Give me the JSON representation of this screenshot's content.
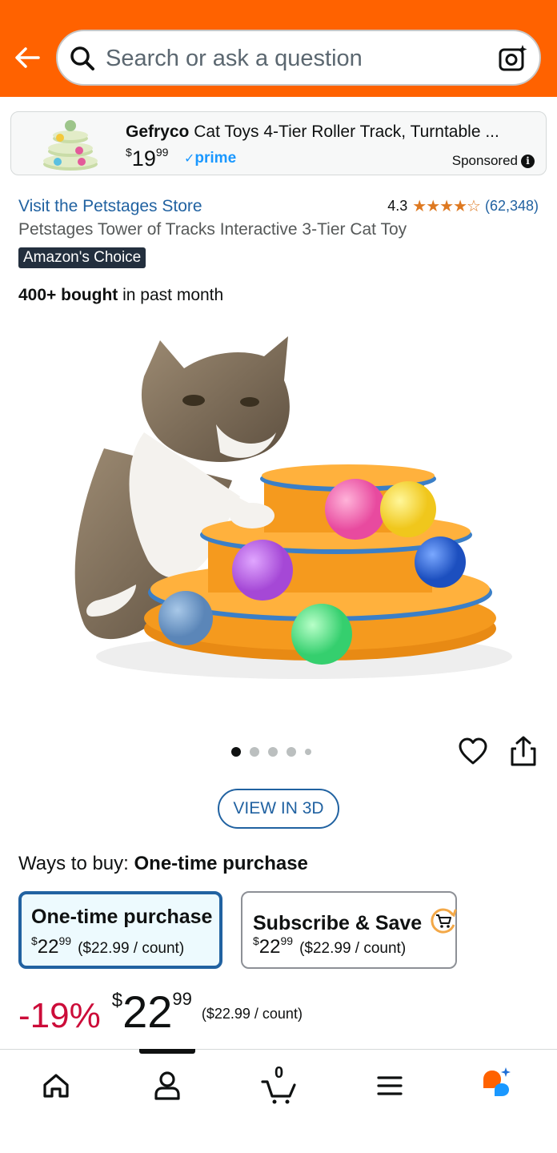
{
  "header": {
    "back_icon": "back-arrow-icon",
    "search_placeholder": "Search or ask a question",
    "camera_icon": "camera-search-icon"
  },
  "sponsored_ad": {
    "brand": "Gefryco",
    "title": "Cat Toys 4-Tier Roller Track, Turntable ...",
    "price_currency": "$",
    "price_whole": "19",
    "price_fraction": "99",
    "prime_label": "prime",
    "sponsored_label": "Sponsored",
    "info_glyph": "i"
  },
  "product": {
    "store_link": "Visit the Petstages Store",
    "rating_value": "4.3",
    "rating_stars": "★★★★☆",
    "rating_count": "(62,348)",
    "title": "Petstages Tower of Tracks Interactive 3-Tier Cat Toy",
    "badge": "Amazon's Choice",
    "bought_bold": "400+ bought",
    "bought_rest": " in past month",
    "carousel_dots": 5,
    "carousel_active": 0
  },
  "view3d_label": "VIEW IN 3D",
  "ways_to_buy": {
    "label": "Ways to buy:",
    "selected": "One-time purchase",
    "options": [
      {
        "title": "One-time purchase",
        "currency": "$",
        "whole": "22",
        "fraction": "99",
        "unit": "($22.99 / count)"
      },
      {
        "title": "Subscribe & Save",
        "currency": "$",
        "whole": "22",
        "fraction": "99",
        "unit": "($22.99 / count)"
      }
    ]
  },
  "price": {
    "discount": "-19%",
    "currency": "$",
    "whole": "22",
    "fraction": "99",
    "unit": "($22.99 / count)"
  },
  "bottom_nav": {
    "cart_count": "0",
    "items": [
      "home-icon",
      "account-icon",
      "cart-icon",
      "menu-icon",
      "rufus-icon"
    ]
  },
  "colors": {
    "header_bg": "#ff6200",
    "link": "#2162a1",
    "discount": "#cc0c39",
    "stars": "#de7921",
    "prime": "#1a98ff"
  }
}
